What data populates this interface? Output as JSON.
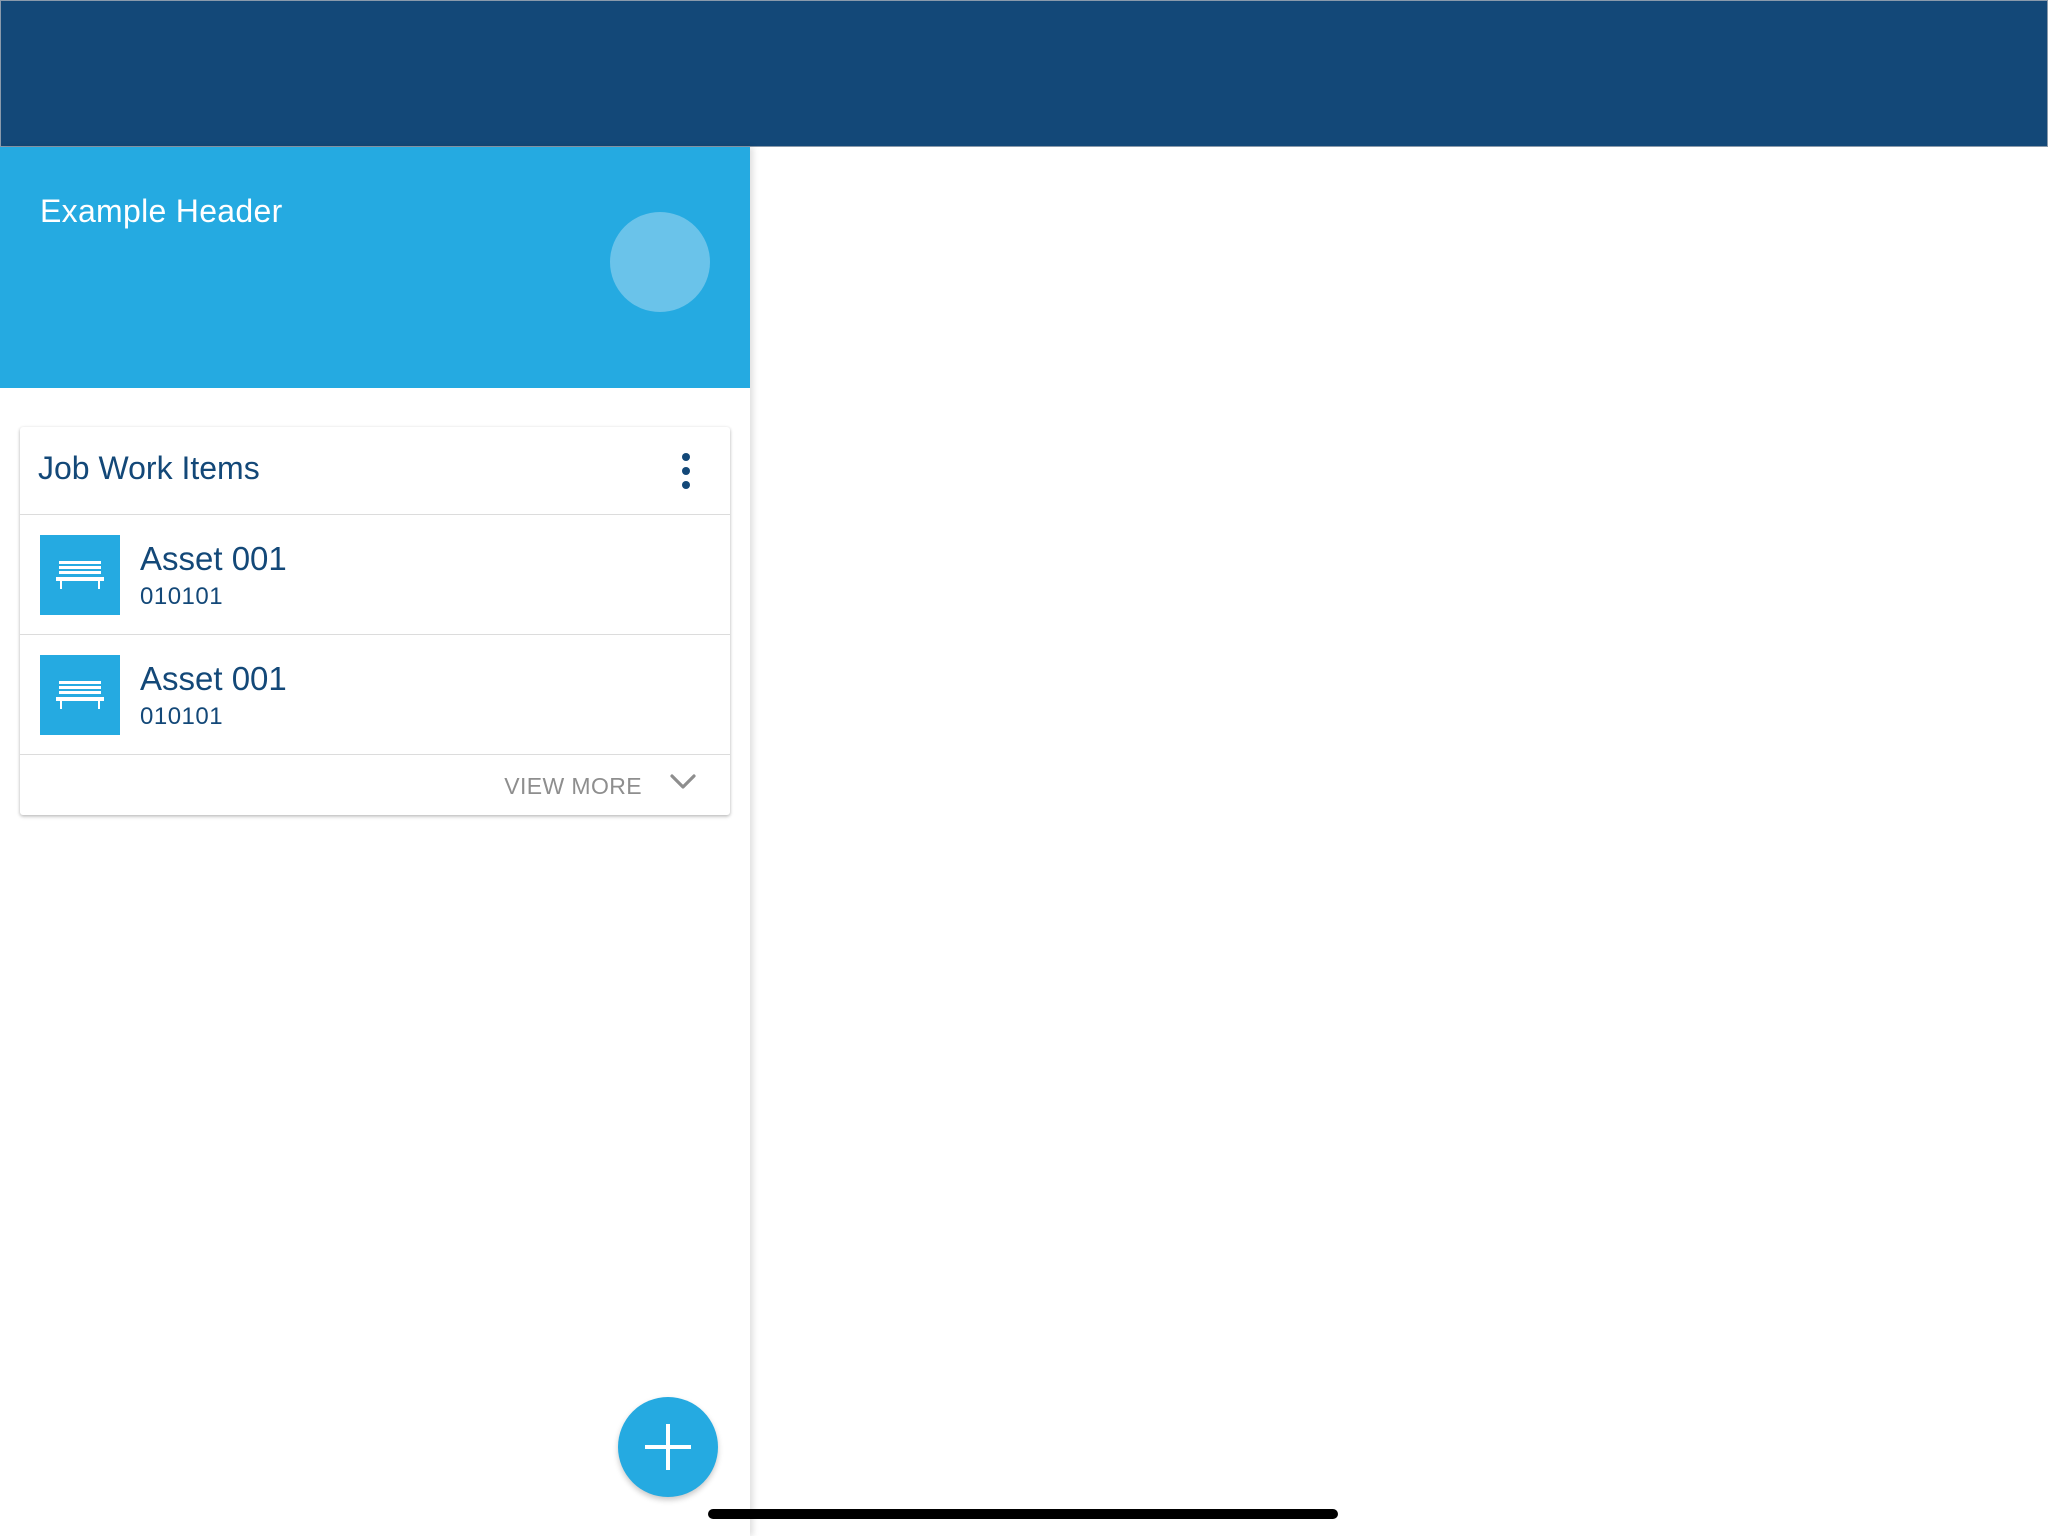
{
  "panel": {
    "header_title": "Example Header"
  },
  "card": {
    "title": "Job Work Items",
    "items": [
      {
        "title": "Asset 001",
        "subtitle": "010101",
        "icon": "bench-icon"
      },
      {
        "title": "Asset 001",
        "subtitle": "010101",
        "icon": "bench-icon"
      }
    ],
    "view_more_label": "VIEW MORE"
  },
  "icons": {
    "menu": "more-vertical-icon",
    "expand": "chevron-down-icon",
    "fab": "plus-icon"
  },
  "colors": {
    "top_bar": "#134878",
    "accent": "#25aae1",
    "avatar": "#6ac3ea",
    "text_primary": "#134878",
    "text_muted": "#8e8e8e"
  }
}
